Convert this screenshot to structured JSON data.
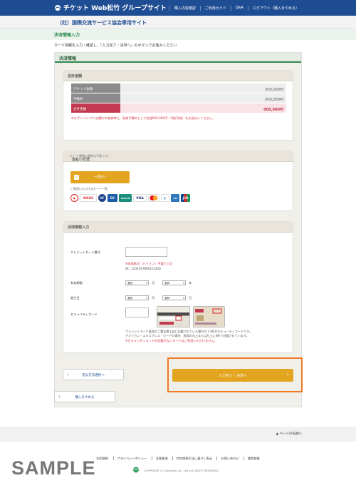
{
  "header": {
    "logo_text": "チケット Web松竹 グループサイト",
    "nav": [
      "購入内容確認",
      "ご利用ガイド",
      "Q&A",
      "ログアウト（購入をやめる）"
    ]
  },
  "site_title": "（社）国際交流サービス協会専用サイト",
  "page_title": "決済情報入力",
  "instruction": "カード情報を入力・確認し、「入力完了・決済へ」のボタンでお進みください",
  "main": {
    "heading": "決済情報",
    "amount": {
      "heading": "合計金額",
      "rows": [
        {
          "label": "チケット金額",
          "value": "000,000円"
        },
        {
          "label": "手数料",
          "value": "000,000円"
        },
        {
          "label": "合計金額",
          "value": "000,000円"
        }
      ],
      "note": "※セブン-イレブン店舗での発券時に、発券手数料として別途000,000円（1枚円/枚）をお支払いください。"
    },
    "payment_method": {
      "heading": "支払い方法",
      "heading_note": "（カード種類の選択は不要です）",
      "option_label": "一括払い",
      "cards_label": "ご利用いただけるカード一覧",
      "cards": [
        "NICOS",
        "UC",
        "DC",
        "SAISON",
        "VISA",
        "MasterCard",
        "Diners",
        "AMEX",
        "JCB"
      ]
    },
    "payment_input": {
      "heading": "決済情報入力",
      "card_number_label": "クレジットカード番号",
      "card_number_value": "",
      "card_note1": "※半角数字（ハイフン）不要で入力",
      "card_note2": "例）1234567890123456",
      "expiry_label": "有効期限",
      "expiry_month": "選択",
      "expiry_month_unit": "月",
      "expiry_year": "選択",
      "expiry_year_unit": "年",
      "birth_label": "誕生日",
      "birth_month": "選択",
      "birth_month_unit": "月",
      "birth_day": "選択",
      "birth_day_unit": "日",
      "security_label": "セキュリティコード",
      "security_value": "",
      "security_note1": "クレジットカード裏面のご署名欄上部に記載されている番号の下3桁がセキュリティコードです。",
      "security_note2": "アメリカン・エキスプレス・カードの場合、表面の右上または左上に4桁で記載されています。",
      "security_note3": "※セキュリティコードの記載がないカードはご利用いただけません。"
    },
    "back_button": "支払方法選択へ",
    "submit_button": "入力完了・決済へ"
  },
  "cancel_button": "購入をやめる",
  "footer": {
    "page_top": "▲ ページの先頭へ",
    "links": [
      "利用規約",
      "プライバシーポリシー",
      "注意事項",
      "特定商取引法に基づく表示",
      "お問い合わせ",
      "運営組織"
    ],
    "copyright": "COPYRIGHT (C) shochiku co., Ltd ALL RIGHT RESERVED."
  },
  "watermark": "SAMPLE",
  "colors": {
    "header_bg": "#1f4d93",
    "accent_green": "#2f8a4c",
    "button_orange": "#e3a51f",
    "total_red": "#c23950",
    "highlight_orange": "#ef7a26"
  }
}
